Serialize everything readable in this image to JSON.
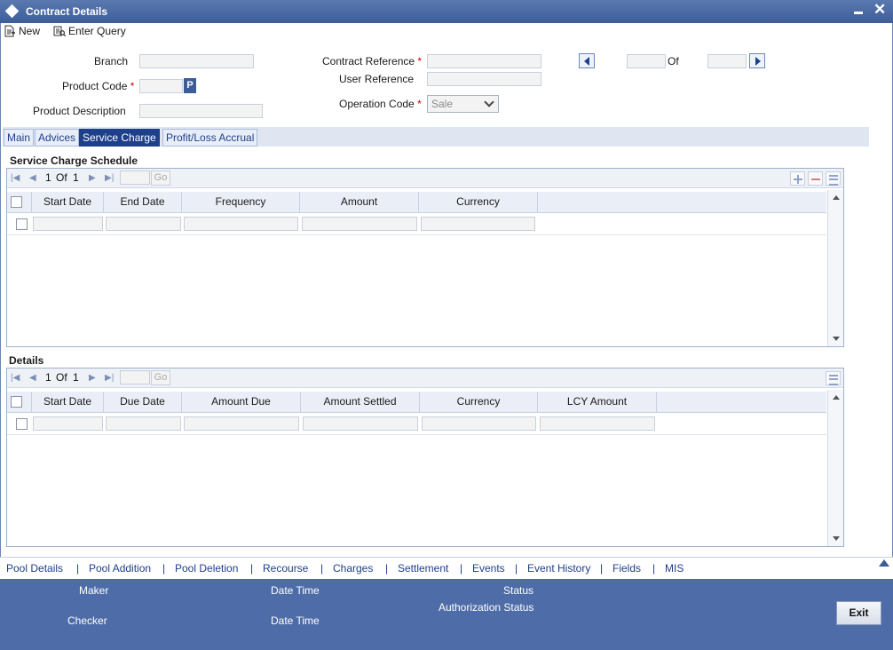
{
  "window": {
    "title": "Contract Details"
  },
  "toolbar": {
    "new_label": "New",
    "enter_query_label": "Enter Query"
  },
  "form": {
    "branch_label": "Branch",
    "product_code_label": "Product Code",
    "product_code_button": "P",
    "product_description_label": "Product Description",
    "contract_reference_label": "Contract Reference",
    "user_reference_label": "User Reference",
    "operation_code_label": "Operation Code",
    "operation_code_value": "Sale",
    "of_label": "Of",
    "required_marker": "*"
  },
  "tabs": [
    {
      "label": "Main",
      "active": false
    },
    {
      "label": "Advices",
      "active": false
    },
    {
      "label": "Service Charge",
      "active": true
    },
    {
      "label": "Profit/Loss Accrual",
      "active": false
    }
  ],
  "schedule": {
    "title": "Service Charge Schedule",
    "pager": {
      "current": "1",
      "of_label": "Of",
      "total": "1",
      "go_label": "Go"
    },
    "columns": [
      "Start Date",
      "End Date",
      "Frequency",
      "Amount",
      "Currency"
    ]
  },
  "details": {
    "title": "Details",
    "pager": {
      "current": "1",
      "of_label": "Of",
      "total": "1",
      "go_label": "Go"
    },
    "columns": [
      "Start Date",
      "Due Date",
      "Amount Due",
      "Amount Settled",
      "Currency",
      "LCY Amount"
    ]
  },
  "links": [
    "Pool Details",
    "Pool Addition",
    "Pool Deletion",
    "Recourse",
    "Charges",
    "Settlement",
    "Events",
    "Event History",
    "Fields",
    "MIS"
  ],
  "link_separator": "|",
  "footer": {
    "maker_label": "Maker",
    "checker_label": "Checker",
    "date_time_label": "Date Time",
    "status_label": "Status",
    "authorization_status_label": "Authorization Status",
    "exit_label": "Exit"
  },
  "colors": {
    "title_bar": "#3d5d98",
    "active_tab": "#1e3f8a",
    "footer": "#4e6da8",
    "link": "#1e3f8a",
    "required": "#cc0000"
  }
}
